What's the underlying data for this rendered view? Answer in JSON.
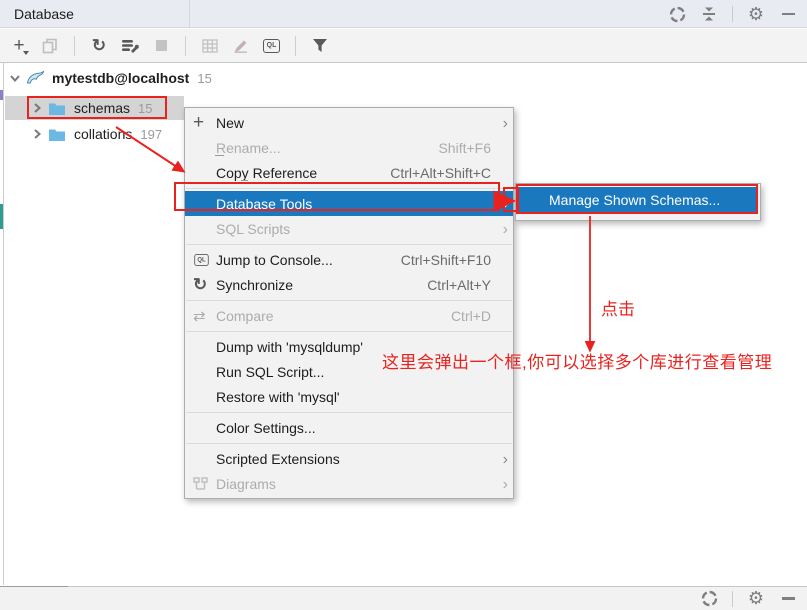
{
  "header": {
    "tab_label": "Database",
    "icons": [
      "segmented-circle-icon",
      "collapse-icon",
      "gear-icon",
      "hide-icon"
    ]
  },
  "toolbar": {
    "icons": [
      "add-icon",
      "copy-icon",
      "refresh-icon",
      "data-source-properties-icon",
      "stop-icon",
      "table-grid-icon",
      "edit-pencil-icon",
      "console-icon",
      "filter-icon"
    ]
  },
  "tree": {
    "connection": {
      "label": "mytestdb@localhost",
      "count": "15",
      "icon": "mysql-dolphin-icon"
    },
    "nodes": [
      {
        "label": "schemas",
        "count": "15",
        "icon": "folder-icon"
      },
      {
        "label": "collations",
        "count": "197",
        "icon": "folder-icon"
      }
    ]
  },
  "context_menu": {
    "items": [
      {
        "label": "New",
        "shortcut": "",
        "icon": "plus-icon",
        "has_submenu": true,
        "state": "enabled"
      },
      {
        "label": "Rename...",
        "shortcut": "Shift+F6",
        "state": "disabled"
      },
      {
        "label": "Copy Reference",
        "shortcut": "Ctrl+Alt+Shift+C",
        "state": "enabled"
      },
      {
        "label": "Database Tools",
        "shortcut": "",
        "has_submenu": true,
        "state": "selected"
      },
      {
        "label": "SQL Scripts",
        "shortcut": "",
        "has_submenu": true,
        "state": "disabled"
      },
      {
        "label": "Jump to Console...",
        "shortcut": "Ctrl+Shift+F10",
        "icon": "console-icon",
        "state": "enabled"
      },
      {
        "label": "Synchronize",
        "shortcut": "Ctrl+Alt+Y",
        "icon": "refresh-icon",
        "state": "enabled"
      },
      {
        "label": "Compare",
        "shortcut": "Ctrl+D",
        "icon": "compare-icon",
        "state": "disabled"
      },
      {
        "label": "Dump with 'mysqldump'",
        "shortcut": "",
        "state": "enabled"
      },
      {
        "label": "Run SQL Script...",
        "shortcut": "",
        "state": "enabled"
      },
      {
        "label": "Restore with 'mysql'",
        "shortcut": "",
        "state": "enabled"
      },
      {
        "label": "Color Settings...",
        "shortcut": "",
        "state": "enabled"
      },
      {
        "label": "Scripted Extensions",
        "shortcut": "",
        "has_submenu": true,
        "state": "enabled"
      },
      {
        "label": "Diagrams",
        "shortcut": "",
        "icon": "diagram-icon",
        "has_submenu": true,
        "state": "disabled"
      }
    ]
  },
  "submenu": {
    "items": [
      {
        "label": "Manage Shown Schemas...",
        "state": "selected"
      }
    ]
  },
  "annotations": {
    "click_label": "点击",
    "note_text": "这里会弹出一个框,你可以选择多个库进行查看管理"
  },
  "colors": {
    "selection_blue": "#1a78be",
    "annotation_red": "#e8231f",
    "folder_blue": "#6cb8e4",
    "header_bg": "#e9ebf2",
    "tree_selection_gray": "#d4d4d4"
  }
}
